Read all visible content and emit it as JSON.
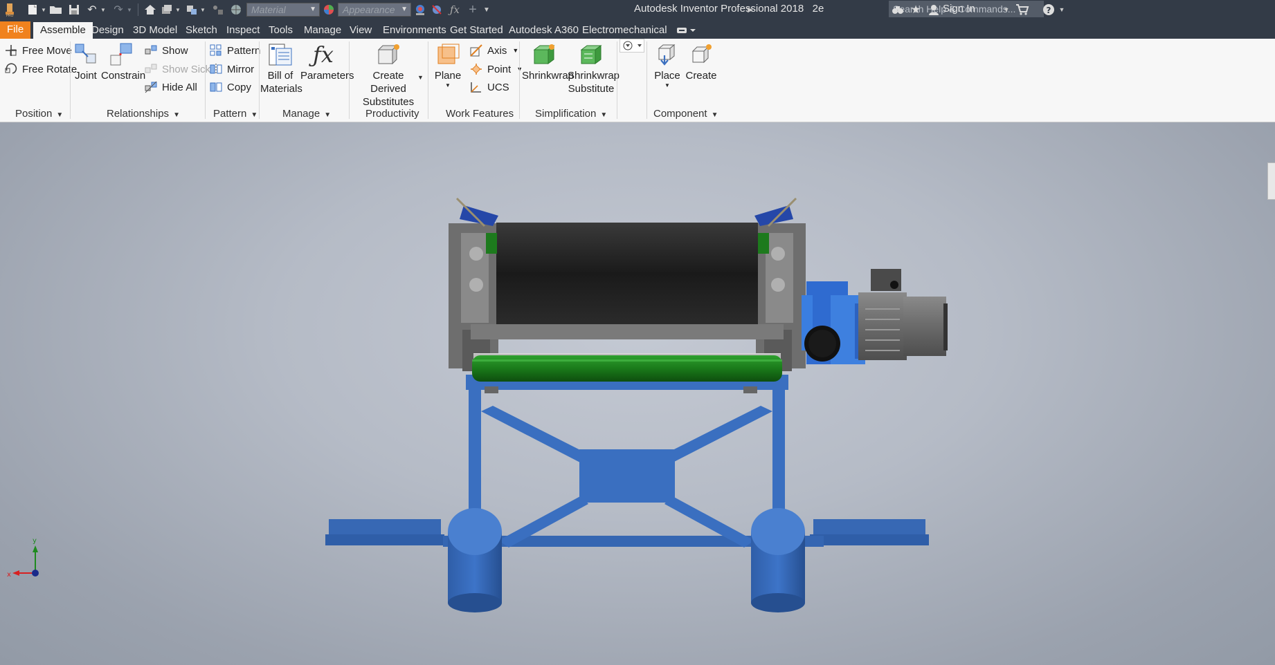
{
  "window": {
    "title": "Autodesk Inventor Professional 2018",
    "doc_name": "2e"
  },
  "quick_access": {
    "material_placeholder": "Material",
    "appearance_placeholder": "Appearance",
    "search_placeholder": "Search Help & Commands...",
    "sign_in": "Sign In"
  },
  "tabs": [
    {
      "label": "File"
    },
    {
      "label": "Assemble",
      "active": true
    },
    {
      "label": "Design"
    },
    {
      "label": "3D Model"
    },
    {
      "label": "Sketch"
    },
    {
      "label": "Inspect"
    },
    {
      "label": "Tools"
    },
    {
      "label": "Manage"
    },
    {
      "label": "View"
    },
    {
      "label": "Environments"
    },
    {
      "label": "Get Started"
    },
    {
      "label": "Autodesk A360"
    },
    {
      "label": "Electromechanical"
    }
  ],
  "ribbon": {
    "position": {
      "label": "Position",
      "free_move": "Free Move",
      "free_rotate": "Free Rotate"
    },
    "relationships": {
      "label": "Relationships",
      "joint": "Joint",
      "constrain": "Constrain",
      "show": "Show",
      "show_sick": "Show Sick",
      "hide_all": "Hide All"
    },
    "pattern": {
      "label": "Pattern",
      "pattern": "Pattern",
      "mirror": "Mirror",
      "copy": "Copy"
    },
    "manage": {
      "label": "Manage",
      "bom_line1": "Bill of",
      "bom_line2": "Materials",
      "parameters": "Parameters"
    },
    "productivity": {
      "label": "Productivity",
      "cds_line1": "Create Derived",
      "cds_line2": "Substitutes"
    },
    "work_features": {
      "label": "Work Features",
      "plane": "Plane",
      "axis": "Axis",
      "point": "Point",
      "ucs": "UCS"
    },
    "simplification": {
      "label": "Simplification",
      "shrinkwrap": "Shrinkwrap",
      "sws_line1": "Shrinkwrap",
      "sws_line2": "Substitute"
    },
    "component": {
      "label": "Component",
      "place": "Place",
      "create": "Create"
    }
  },
  "viewport": {
    "axis_x_label": "x",
    "axis_y_label": "y"
  },
  "colors": {
    "file_tab": "#f0821e",
    "title_bar": "#333b47",
    "frame_blue": "#3a6fc0",
    "belt_green": "#1f8a1f",
    "drum_black": "#1e1e1e"
  }
}
